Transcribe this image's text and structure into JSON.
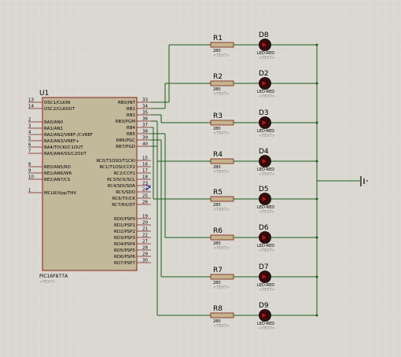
{
  "colors": {
    "background": "#d9d7cf",
    "grid": "#e6e4dd",
    "chip_fill": "#c2b89a",
    "chip_border": "#8a2020",
    "wire": "#1b5e1b",
    "text": "#000000",
    "muted": "#8a8a8a",
    "led_fill": "#3b0d0d",
    "resistor_fill": "#c6b48c",
    "pin_line": "#7a1c1c"
  },
  "chip": {
    "ref": "U1",
    "part": "PIC16F877A",
    "text_placeholder": "<TEXT>",
    "left_pins": [
      {
        "num": "13",
        "name": "OSC1/CLKIN"
      },
      {
        "num": "14",
        "name": "OSC2/CLKOUT"
      },
      {
        "num": "2",
        "name": "RA0/AN0"
      },
      {
        "num": "3",
        "name": "RA1/AN1"
      },
      {
        "num": "4",
        "name": "RA2/AN2/VREF-/CVREF"
      },
      {
        "num": "5",
        "name": "RA3/AN3/VREF+"
      },
      {
        "num": "6",
        "name": "RA4/T0CKI/C1OUT"
      },
      {
        "num": "7",
        "name": "RA5/AN4/SS/C2OUT"
      },
      {
        "num": "8",
        "name": "RE0/AN5/RD"
      },
      {
        "num": "9",
        "name": "RE1/AN6/WR"
      },
      {
        "num": "10",
        "name": "RE2/AN7/CS"
      },
      {
        "num": "1",
        "name": "MCLR/Vpp/THV"
      }
    ],
    "right_pins": [
      {
        "num": "33",
        "name": "RB0/INT"
      },
      {
        "num": "34",
        "name": "RB1"
      },
      {
        "num": "35",
        "name": "RB2"
      },
      {
        "num": "36",
        "name": "RB3/PGM"
      },
      {
        "num": "37",
        "name": "RB4"
      },
      {
        "num": "38",
        "name": "RB5"
      },
      {
        "num": "39",
        "name": "RB6/PGC"
      },
      {
        "num": "40",
        "name": "RB7/PGD"
      },
      {
        "num": "15",
        "name": "RC0/T1OSO/T1CKI"
      },
      {
        "num": "16",
        "name": "RC1/T1OSI/CCP2"
      },
      {
        "num": "17",
        "name": "RC2/CCP1"
      },
      {
        "num": "18",
        "name": "RC3/SCK/SCL"
      },
      {
        "num": "23",
        "name": "RC4/SDI/SDA"
      },
      {
        "num": "24",
        "name": "RC5/SDO"
      },
      {
        "num": "25",
        "name": "RC6/TX/CK"
      },
      {
        "num": "26",
        "name": "RC7/RX/DT"
      },
      {
        "num": "19",
        "name": "RD0/PSP0"
      },
      {
        "num": "20",
        "name": "RD1/PSP1"
      },
      {
        "num": "21",
        "name": "RD2/PSP2"
      },
      {
        "num": "22",
        "name": "RD3/PSP3"
      },
      {
        "num": "27",
        "name": "RD4/PSP4"
      },
      {
        "num": "28",
        "name": "RD5/PSP5"
      },
      {
        "num": "29",
        "name": "RD6/PSP6"
      },
      {
        "num": "30",
        "name": "RD7/PSP7"
      }
    ]
  },
  "branches": [
    {
      "resistor": "R1",
      "value": "280",
      "text": "<TEXT>",
      "led": "D8",
      "led_type": "LED-RED",
      "led_text": "<TEXT>"
    },
    {
      "resistor": "R2",
      "value": "280",
      "text": "<TEXT>",
      "led": "D2",
      "led_type": "LED-RED",
      "led_text": "<TEXT>"
    },
    {
      "resistor": "R3",
      "value": "280",
      "text": "<TEXT>",
      "led": "D3",
      "led_type": "LED-RED",
      "led_text": "<TEXT>"
    },
    {
      "resistor": "R4",
      "value": "280",
      "text": "<TEXT>",
      "led": "D4",
      "led_type": "LED-RED",
      "led_text": "<TEXT>"
    },
    {
      "resistor": "R5",
      "value": "280",
      "text": "<TEXT>",
      "led": "D5",
      "led_type": "LED-RED",
      "led_text": "<TEXT>"
    },
    {
      "resistor": "R6",
      "value": "280",
      "text": "<TEXT>",
      "led": "D6",
      "led_type": "LED-RED",
      "led_text": "<TEXT>"
    },
    {
      "resistor": "R7",
      "value": "280",
      "text": "<TEXT>",
      "led": "D7",
      "led_type": "LED-RED",
      "led_text": "<TEXT>"
    },
    {
      "resistor": "R8",
      "value": "280",
      "text": "<TEXT>",
      "led": "D9",
      "led_type": "LED-RED",
      "led_text": "<TEXT>"
    }
  ]
}
